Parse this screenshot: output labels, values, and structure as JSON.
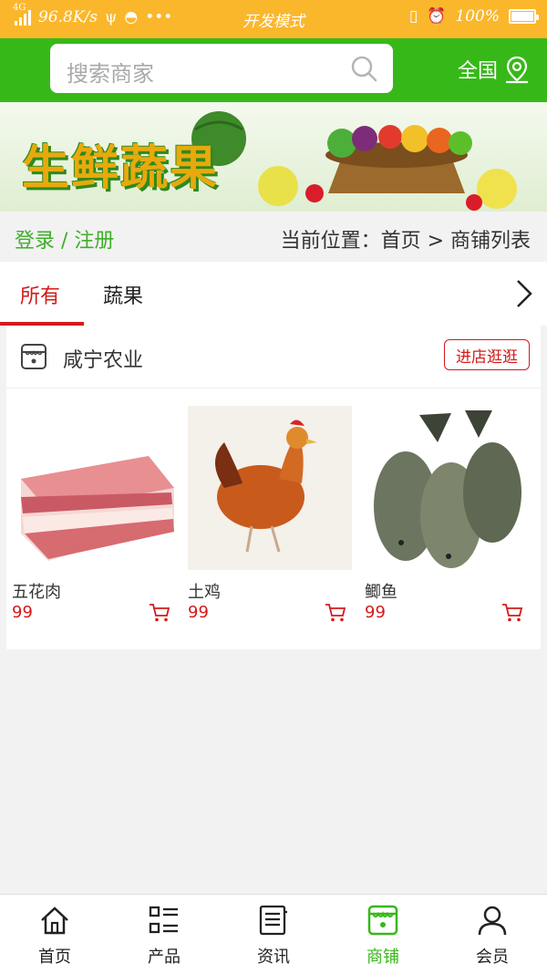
{
  "status_bar": {
    "network": "4G",
    "speed": "96.8K/s",
    "mode": "开发模式",
    "battery": "100%"
  },
  "header": {
    "search_placeholder": "搜索商家",
    "region_label": "全国"
  },
  "banner": {
    "title": "生鲜蔬果"
  },
  "crumbbar": {
    "login_label": "登录 / 注册",
    "location": "当前位置：首页 > 商铺列表"
  },
  "tabs": [
    {
      "label": "所有",
      "active": true
    },
    {
      "label": "蔬果",
      "active": false
    }
  ],
  "store": {
    "name": "咸宁农业",
    "visit_label": "进店逛逛",
    "products": [
      {
        "name": "五花肉",
        "price": "99"
      },
      {
        "name": "土鸡",
        "price": "99"
      },
      {
        "name": "鲫鱼",
        "price": "99"
      }
    ]
  },
  "tabbar": {
    "items": [
      {
        "label": "首页",
        "icon": "home-icon"
      },
      {
        "label": "产品",
        "icon": "list-icon"
      },
      {
        "label": "资讯",
        "icon": "news-icon"
      },
      {
        "label": "商铺",
        "icon": "store-icon",
        "active": true
      },
      {
        "label": "会员",
        "icon": "user-icon"
      }
    ]
  },
  "colors": {
    "brand_green": "#37b819",
    "accent_red": "#d31a1a",
    "status_bar": "#fbb72b"
  }
}
